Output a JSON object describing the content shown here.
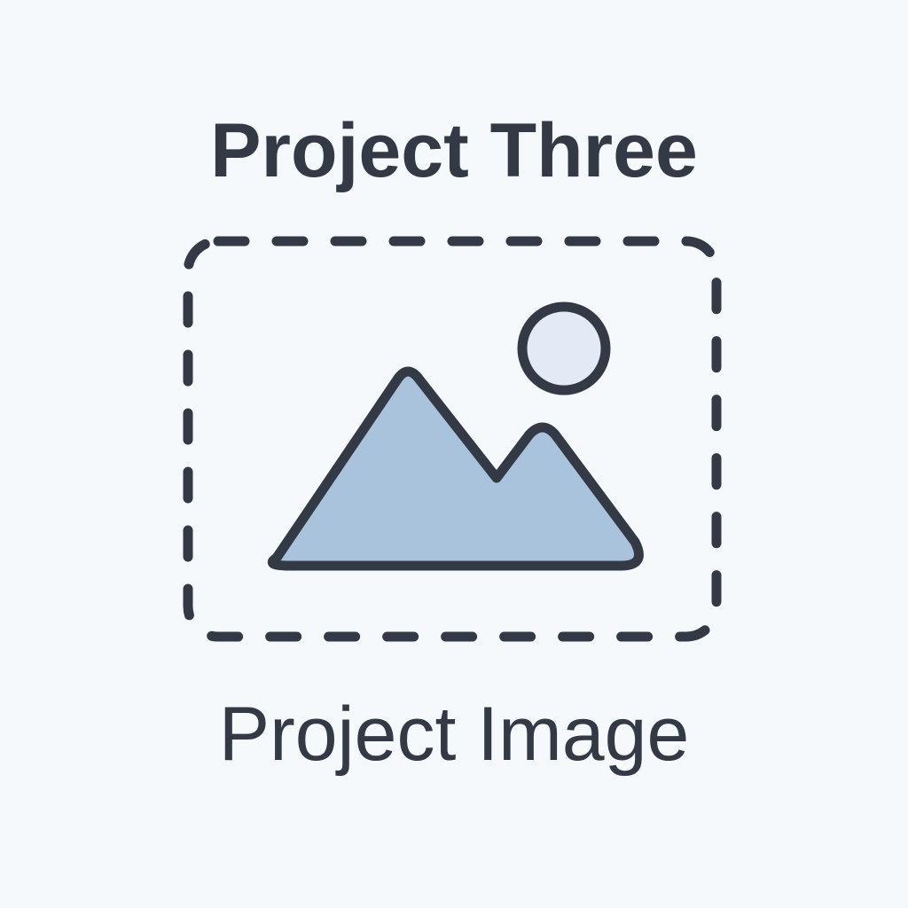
{
  "project": {
    "title": "Project Three",
    "image_caption": "Project Image"
  },
  "icons": {
    "placeholder": "image-placeholder-icon",
    "mountains": "mountain-icon",
    "sun": "sun-icon"
  },
  "colors": {
    "background": "#f6f9fc",
    "text": "#333a45",
    "stroke": "#333a45",
    "mountain_fill": "#a9c3dd",
    "sun_fill": "#e2ebf5"
  }
}
